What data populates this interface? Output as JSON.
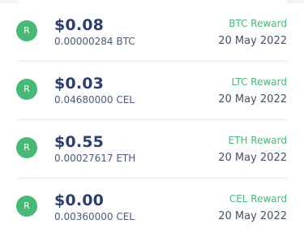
{
  "transactions": [
    {
      "avatar": "R",
      "usd": "$0.08",
      "crypto": "0.00000284 BTC",
      "reward": "BTC Reward",
      "date": "20 May 2022"
    },
    {
      "avatar": "R",
      "usd": "$0.03",
      "crypto": "0.04680000 CEL",
      "reward": "LTC Reward",
      "date": "20 May 2022"
    },
    {
      "avatar": "R",
      "usd": "$0.55",
      "crypto": "0.00027617 ETH",
      "reward": "ETH Reward",
      "date": "20 May 2022"
    },
    {
      "avatar": "R",
      "usd": "$0.00",
      "crypto": "0.00360000 CEL",
      "reward": "CEL Reward",
      "date": "20 May 2022"
    }
  ],
  "colors": {
    "avatar_bg": "#47b977",
    "reward_text": "#47b977",
    "usd_text": "#2b3f73"
  }
}
